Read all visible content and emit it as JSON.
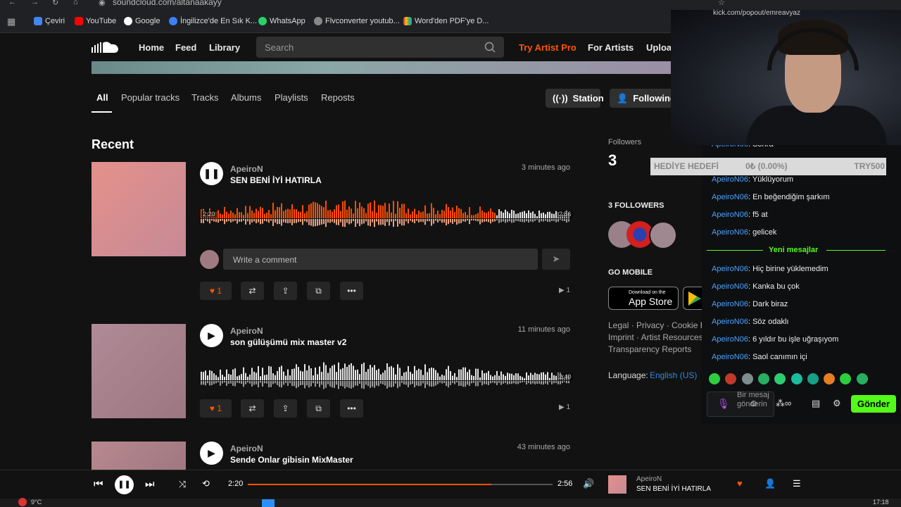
{
  "browser": {
    "url": "soundcloud.com/altanaakayy",
    "bookmarks": [
      {
        "label": "Çeviri",
        "color": "#4285f4"
      },
      {
        "label": "YouTube",
        "color": "#ff0000"
      },
      {
        "label": "Google",
        "color": "#ea4335"
      },
      {
        "label": "İngilizce'de En Sık K...",
        "color": "#3b82f6"
      },
      {
        "label": "WhatsApp",
        "color": "#25d366"
      },
      {
        "label": "Flvconverter youtub...",
        "color": "#888888"
      },
      {
        "label": "Word'den PDF'ye D...",
        "color": "#e91e63"
      }
    ]
  },
  "header": {
    "home": "Home",
    "feed": "Feed",
    "library": "Library",
    "search_placeholder": "Search",
    "try_pro": "Try Artist Pro",
    "for_artists": "For Artists",
    "upload": "Upload"
  },
  "tabs": [
    "All",
    "Popular tracks",
    "Tracks",
    "Albums",
    "Playlists",
    "Reposts"
  ],
  "actions": {
    "station": "Station",
    "following": "Following"
  },
  "section_title": "Recent",
  "tracks": [
    {
      "artist": "ApeiroN",
      "title": "SEN BENİ İYİ HATIRLA",
      "ago": "3 minutes ago",
      "likes": "1",
      "plays": "1",
      "elapsed": "2:20",
      "duration": "2:56",
      "progress": 0.8,
      "art": "#d98a86",
      "playing": true
    },
    {
      "artist": "ApeiroN",
      "title": "son gülüşümü mix master v2",
      "ago": "11 minutes ago",
      "likes": "1",
      "plays": "1",
      "duration": "2:40",
      "progress": 0,
      "art": "#a87a86",
      "playing": false
    },
    {
      "artist": "ApeiroN",
      "title": "Sende Onlar gibisin MixMaster",
      "ago": "43 minutes ago",
      "art": "#b08088",
      "playing": false
    }
  ],
  "comment_placeholder": "Write a comment",
  "sidebar": {
    "followers_label": "Followers",
    "followers_count": "3",
    "followers_heading": "3 FOLLOWERS",
    "go_mobile": "GO MOBILE",
    "appstore_small": "Download on the",
    "appstore_big": "App Store",
    "footer_line1": "Legal · Privacy · Cookie Po",
    "footer_line2": "Imprint · Artist Resources",
    "footer_line3": "Transparency Reports",
    "language_label": "Language:",
    "language_value": "English (US)"
  },
  "gift": {
    "label": "HEDİYE HEDEFİ",
    "progress": "0₺ (0.00%)",
    "target": "TRY500"
  },
  "chat": {
    "user": "ApeiroN06",
    "messages_before": [
      {
        "user": "ApeiroN06",
        "text": ": Sonra"
      },
      {
        "user": "ApeiroN06",
        "text": ": Yüklüyorum"
      },
      {
        "user": "ApeiroN06",
        "text": ": En beğendiğim şarkım"
      },
      {
        "user": "ApeiroN06",
        "text": ": f5 at"
      },
      {
        "user": "ApeiroN06",
        "text": ": gelicek"
      }
    ],
    "new_messages": "Yeni mesajlar",
    "messages_after": [
      {
        "user": "ApeiroN06",
        "text": ": Hiç birine yüklemedim"
      },
      {
        "user": "ApeiroN06",
        "text": ": Kanka bu çok"
      },
      {
        "user": "ApeiroN06",
        "text": ": Dark biraz"
      },
      {
        "user": "ApeiroN06",
        "text": ": Söz odaklı"
      },
      {
        "user": "ApeiroN06",
        "text": ": 6 yıldır bu işle uğraşıyom"
      },
      {
        "user": "ApeiroN06",
        "text": ": Saol canımın içi"
      }
    ],
    "input_placeholder": "Bir mesaj gönderin",
    "send": "Gönder",
    "popout_url": "kick.com/popout/emreavyaz"
  },
  "player": {
    "elapsed": "2:20",
    "duration": "2:56",
    "progress": 0.8,
    "artist": "ApeiroN",
    "title": "SEN BENİ İYİ HATIRLA"
  },
  "taskbar": {
    "weather": "9°C",
    "time": "17:18"
  }
}
